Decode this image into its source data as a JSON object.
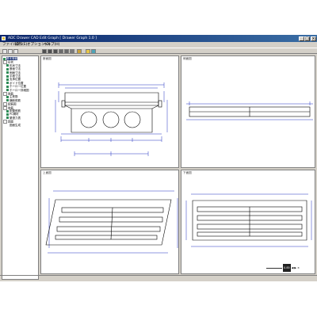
{
  "window": {
    "title": "ADC Drawer CAD Edit Graph [ Drawer Graph 1.0 ]",
    "minimize_glyph": "_",
    "maximize_glyph": "□",
    "close_glyph": "×"
  },
  "menu": {
    "items": [
      "ファイル(F)",
      "操作(E)",
      "オプション(O)",
      "ヘルプ(H)"
    ]
  },
  "toolbar": {
    "buttons": [
      "open-icon",
      "save-icon",
      "print-icon",
      "zoom-icon",
      "view-icon",
      "pan-icon",
      "grid-icon",
      "layer-icon",
      "text-icon",
      "help-icon",
      "info-icon",
      "settings-icon"
    ]
  },
  "sidebar": {
    "items": [
      {
        "label": "基本情報",
        "selected": true
      },
      {
        "label": "形状",
        "selected": false
      },
      {
        "label": "形状寸法",
        "selected": false
      },
      {
        "label": "断面寸法",
        "selected": false
      },
      {
        "label": "側面寸法",
        "selected": false
      },
      {
        "label": "平面寸法",
        "selected": false
      },
      {
        "label": "支承位置",
        "selected": false
      },
      {
        "label": "ボイド位置",
        "selected": false
      },
      {
        "label": "ホーロー位置",
        "selected": false
      },
      {
        "label": "ホーロー詳細図",
        "selected": false
      },
      {
        "label": "鉄筋",
        "selected": false
      },
      {
        "label": "主鉄筋",
        "selected": false
      },
      {
        "label": "横断鉄筋",
        "selected": false
      },
      {
        "label": "配筋図",
        "selected": false
      },
      {
        "label": "鉄筋",
        "selected": false
      },
      {
        "label": "配置鉄筋",
        "selected": false
      },
      {
        "label": "PC鋼材",
        "selected": false
      },
      {
        "label": "緊張力表",
        "selected": false
      },
      {
        "label": "図面",
        "selected": false
      },
      {
        "label": "図面生成",
        "selected": false
      }
    ]
  },
  "panes": {
    "section": {
      "label": "断面図"
    },
    "side": {
      "label": "側面図"
    },
    "top": {
      "label": "上面図"
    },
    "bottom": {
      "label": "下面図"
    }
  },
  "zoom": {
    "value": "0.85"
  },
  "status": {
    "text": ""
  }
}
